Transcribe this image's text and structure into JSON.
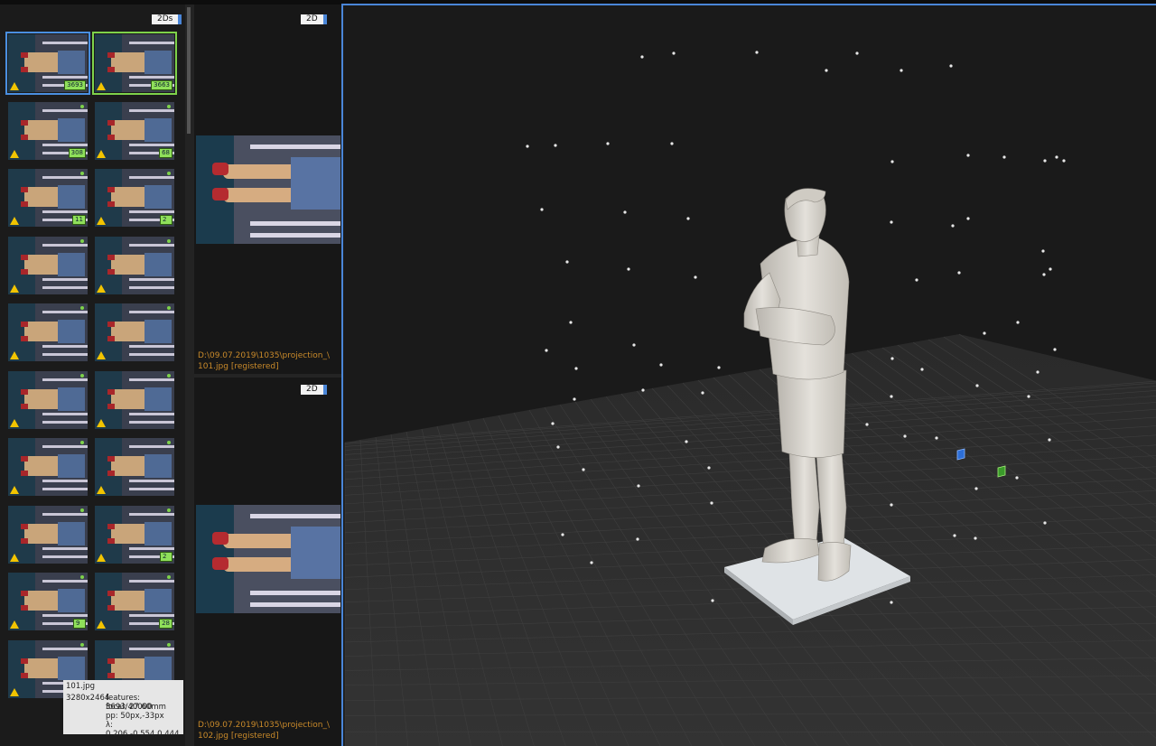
{
  "left_panel": {
    "badge": "2Ds",
    "thumb_counts": [
      "3693",
      "3663",
      "308",
      "68",
      "11",
      "2",
      "",
      "",
      "",
      "",
      "",
      "",
      "",
      "",
      "",
      "2",
      "9",
      "28",
      "",
      ""
    ]
  },
  "tooltip": {
    "filename": "101.jpg",
    "resolution": "3280x2464",
    "features": "features: 3693/40000",
    "focal": "focal: 27.60mm",
    "pp": "pp: 50px,-33px",
    "lambda": "λ: 0.206,-0.554,0.444"
  },
  "panels": [
    {
      "badge": "2D",
      "path_line1": "D:\\09.07.2019\\1035\\projection_\\",
      "path_line2": "101.jpg [registered]"
    },
    {
      "badge": "2D",
      "path_line1": "D:\\09.07.2019\\1035\\projection_\\",
      "path_line2": "102.jpg [registered]"
    }
  ],
  "colors": {
    "selection": "#4a86d8",
    "registered": "#7ed24a",
    "warning": "#f2c400",
    "path_text": "#c98a2a"
  }
}
